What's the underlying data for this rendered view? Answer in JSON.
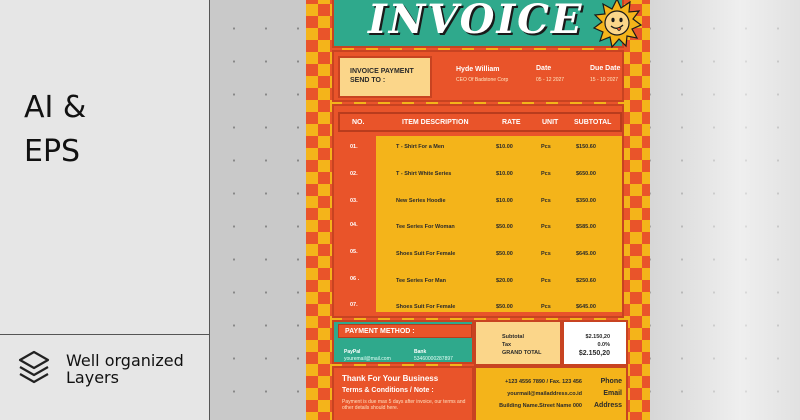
{
  "promo": {
    "format_line1": "AI &",
    "format_line2": "EPS",
    "layers_line1": "Well organized",
    "layers_line2": "Layers",
    "icon": "layers-icon"
  },
  "invoice": {
    "title": "INVOICE",
    "mascot_icon": "smiling-sun-icon",
    "send_to": {
      "line1": "INVOICE PAYMENT",
      "line2": "SEND TO :"
    },
    "client": {
      "name": "Hyde William",
      "role": "CEO Of Badstone Corp"
    },
    "date": {
      "label": "Date",
      "value": "05 - 12 2027"
    },
    "due_date": {
      "label": "Due Date",
      "value": "15 - 10 2027"
    },
    "table": {
      "headers": [
        "NO.",
        "ITEM DESCRIPTION",
        "RATE",
        "UNIT",
        "SUBTOTAL"
      ],
      "rows": [
        {
          "no": "01.",
          "desc": "T - Shirt For a Men",
          "rate": "$10.00",
          "unit": "Pcs",
          "subtotal": "$150.60"
        },
        {
          "no": "02.",
          "desc": "T - Shirt White Series",
          "rate": "$10.00",
          "unit": "Pcs",
          "subtotal": "$650.00"
        },
        {
          "no": "03.",
          "desc": "New Series Hoodie",
          "rate": "$10.00",
          "unit": "Pcs",
          "subtotal": "$350.00"
        },
        {
          "no": "04.",
          "desc": "Tee Series For Woman",
          "rate": "$50.00",
          "unit": "Pcs",
          "subtotal": "$585.00"
        },
        {
          "no": "05.",
          "desc": "Shoes Suit For Female",
          "rate": "$50.00",
          "unit": "Pcs",
          "subtotal": "$645.00"
        },
        {
          "no": "06 .",
          "desc": "Tee Series For Man",
          "rate": "$20.00",
          "unit": "Pcs",
          "subtotal": "$250.60"
        },
        {
          "no": "07.",
          "desc": "Shoes Suit For Female",
          "rate": "$50.00",
          "unit": "Pcs",
          "subtotal": "$645.00"
        }
      ]
    },
    "payment": {
      "title": "PAYMENT METHOD :",
      "paypal_label": "PayPal",
      "paypal_value": "youremail@mail.com",
      "bank_label": "Bank",
      "bank_value": "53460000287897"
    },
    "summary": {
      "subtotal_label": "Subtotal",
      "tax_label": "Tax",
      "grand_total_label": "GRAND TOTAL",
      "subtotal_value": "$2.150,20",
      "tax_value": "0.0%",
      "grand_total_value": "$2.150,20"
    },
    "footer": {
      "thanks": "Thank For Your Business",
      "terms_title": "Terms & Conditions / Note :",
      "terms_text": "Payment is due max 5 days after invoice, our terms and other details should here.",
      "phone_value": "+123 4556 7890 / Fax. 123 456",
      "phone_label": "Phone",
      "email_value": "yourmail@mailaddress.co.id",
      "email_label": "Email",
      "address_value": "Building Name.Street Name 000",
      "address_label": "Address"
    }
  },
  "colors": {
    "orange": "#e9542a",
    "yellow": "#f4b41a",
    "teal": "#2fa98c",
    "cream": "#fbd68a"
  }
}
